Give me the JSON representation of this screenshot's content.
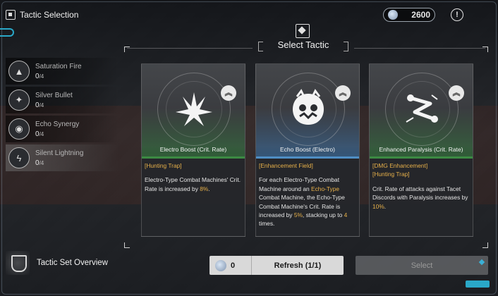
{
  "header": {
    "title": "Tactic Selection",
    "currency_value": "2600",
    "info_glyph": "!"
  },
  "select_title": "Select Tactic",
  "tactics": [
    {
      "name": "Saturation Fire",
      "count": "0",
      "max": "/4",
      "icon": "missile-icon",
      "glyph": "▲"
    },
    {
      "name": "Silver Bullet",
      "count": "0",
      "max": "/4",
      "icon": "bullet-icon",
      "glyph": "✦"
    },
    {
      "name": "Echo Synergy",
      "count": "0",
      "max": "/4",
      "icon": "synergy-icon",
      "glyph": "◉"
    },
    {
      "name": "Silent Lightning",
      "count": "0",
      "max": "/4",
      "icon": "lightning-icon",
      "glyph": "ϟ"
    }
  ],
  "cards": [
    {
      "title": "Electro Boost (Crit. Rate)",
      "tag": "[Hunting Trap]",
      "desc_parts": [
        {
          "text": "Electro-Type Combat Machines' Crit. Rate is increased by ",
          "hl": false
        },
        {
          "text": "8%",
          "hl": true
        },
        {
          "text": ".",
          "hl": false
        }
      ],
      "rank_glyph": "︽",
      "color": "#3c8a43"
    },
    {
      "title": "Echo Boost (Electro)",
      "tag": "[Enhancement Field]",
      "desc_parts": [
        {
          "text": "For each Electro-Type Combat Machine around an ",
          "hl": false
        },
        {
          "text": "Echo-Type",
          "hl": true
        },
        {
          "text": " Combat Machine, the Echo-Type Combat Machine's Crit. Rate is increased by ",
          "hl": false
        },
        {
          "text": "5%",
          "hl": true
        },
        {
          "text": ", stacking up to ",
          "hl": false
        },
        {
          "text": "4",
          "hl": true
        },
        {
          "text": " times.",
          "hl": false
        }
      ],
      "rank_glyph": "︽",
      "color": "#4f8ec4"
    },
    {
      "title": "Enhanced Paralysis (Crit. Rate)",
      "tag": "[DMG Enhancement]\n[Hunting Trap]",
      "desc_parts": [
        {
          "text": "Crit. Rate of attacks against Tacet Discords with Paralysis increases by ",
          "hl": false
        },
        {
          "text": "10%",
          "hl": true
        },
        {
          "text": ".",
          "hl": false
        }
      ],
      "rank_glyph": "︽",
      "color": "#3c8a43"
    }
  ],
  "bottom": {
    "overview_label": "Tactic Set Overview",
    "refresh_cost": "0",
    "refresh_label": "Refresh (1/1)",
    "select_label": "Select"
  },
  "colors": {
    "accent": "#2aa8c8",
    "highlight": "#e6b04a"
  }
}
